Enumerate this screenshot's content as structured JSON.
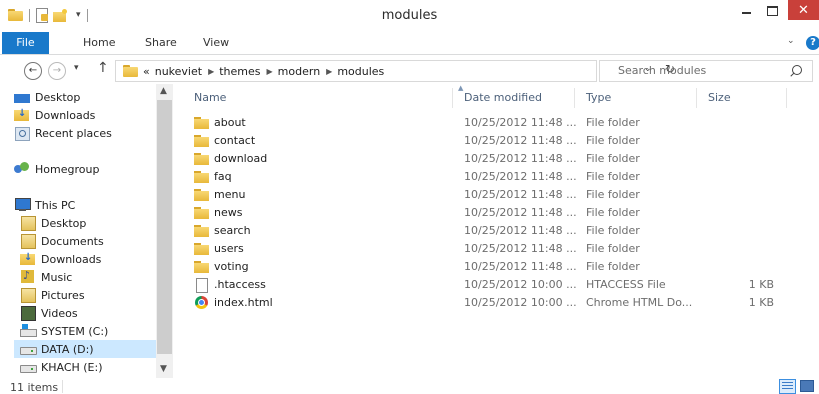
{
  "window": {
    "title": "modules"
  },
  "titlebar": {
    "minimize": "",
    "maximize": "",
    "close": "✕"
  },
  "ribbon": {
    "tabs": [
      "File",
      "Home",
      "Share",
      "View"
    ]
  },
  "address": {
    "overflow": "«",
    "crumbs": [
      "nukeviet",
      "themes",
      "modern",
      "modules"
    ]
  },
  "search": {
    "placeholder": "Search modules"
  },
  "nav": {
    "items": [
      {
        "label": "Desktop",
        "icon": "desktop-icon"
      },
      {
        "label": "Downloads",
        "icon": "downloads-icon"
      },
      {
        "label": "Recent places",
        "icon": "recent-places-icon"
      },
      {
        "label": "Homegroup",
        "icon": "homegroup-icon"
      },
      {
        "label": "This PC",
        "icon": "computer-icon"
      },
      {
        "label": "Desktop",
        "icon": "desktop-icon"
      },
      {
        "label": "Documents",
        "icon": "documents-icon"
      },
      {
        "label": "Downloads",
        "icon": "downloads-icon"
      },
      {
        "label": "Music",
        "icon": "music-icon"
      },
      {
        "label": "Pictures",
        "icon": "pictures-icon"
      },
      {
        "label": "Videos",
        "icon": "videos-icon"
      },
      {
        "label": "SYSTEM (C:)",
        "icon": "system-drive-icon"
      },
      {
        "label": "DATA (D:)",
        "icon": "drive-icon",
        "selected": true
      },
      {
        "label": "KHACH (E:)",
        "icon": "drive-icon"
      }
    ]
  },
  "columns": {
    "name": "Name",
    "date": "Date modified",
    "type": "Type",
    "size": "Size"
  },
  "files": [
    {
      "name": "about",
      "date": "10/25/2012 11:48 ...",
      "type": "File folder",
      "size": "",
      "icon": "folder-icon"
    },
    {
      "name": "contact",
      "date": "10/25/2012 11:48 ...",
      "type": "File folder",
      "size": "",
      "icon": "folder-icon"
    },
    {
      "name": "download",
      "date": "10/25/2012 11:48 ...",
      "type": "File folder",
      "size": "",
      "icon": "folder-icon"
    },
    {
      "name": "faq",
      "date": "10/25/2012 11:48 ...",
      "type": "File folder",
      "size": "",
      "icon": "folder-icon"
    },
    {
      "name": "menu",
      "date": "10/25/2012 11:48 ...",
      "type": "File folder",
      "size": "",
      "icon": "folder-icon"
    },
    {
      "name": "news",
      "date": "10/25/2012 11:48 ...",
      "type": "File folder",
      "size": "",
      "icon": "folder-icon"
    },
    {
      "name": "search",
      "date": "10/25/2012 11:48 ...",
      "type": "File folder",
      "size": "",
      "icon": "folder-icon"
    },
    {
      "name": "users",
      "date": "10/25/2012 11:48 ...",
      "type": "File folder",
      "size": "",
      "icon": "folder-icon"
    },
    {
      "name": "voting",
      "date": "10/25/2012 11:48 ...",
      "type": "File folder",
      "size": "",
      "icon": "folder-icon"
    },
    {
      "name": ".htaccess",
      "date": "10/25/2012 10:00 ...",
      "type": "HTACCESS File",
      "size": "1 KB",
      "icon": "file-icon"
    },
    {
      "name": "index.html",
      "date": "10/25/2012 10:00 ...",
      "type": "Chrome HTML Do...",
      "size": "1 KB",
      "icon": "chrome-icon"
    }
  ],
  "status": {
    "count": "11 items"
  },
  "colors": {
    "file_tab": "#1979ca",
    "close_button": "#c9403a",
    "selection": "#cce8ff",
    "header_text": "#4c607a"
  }
}
